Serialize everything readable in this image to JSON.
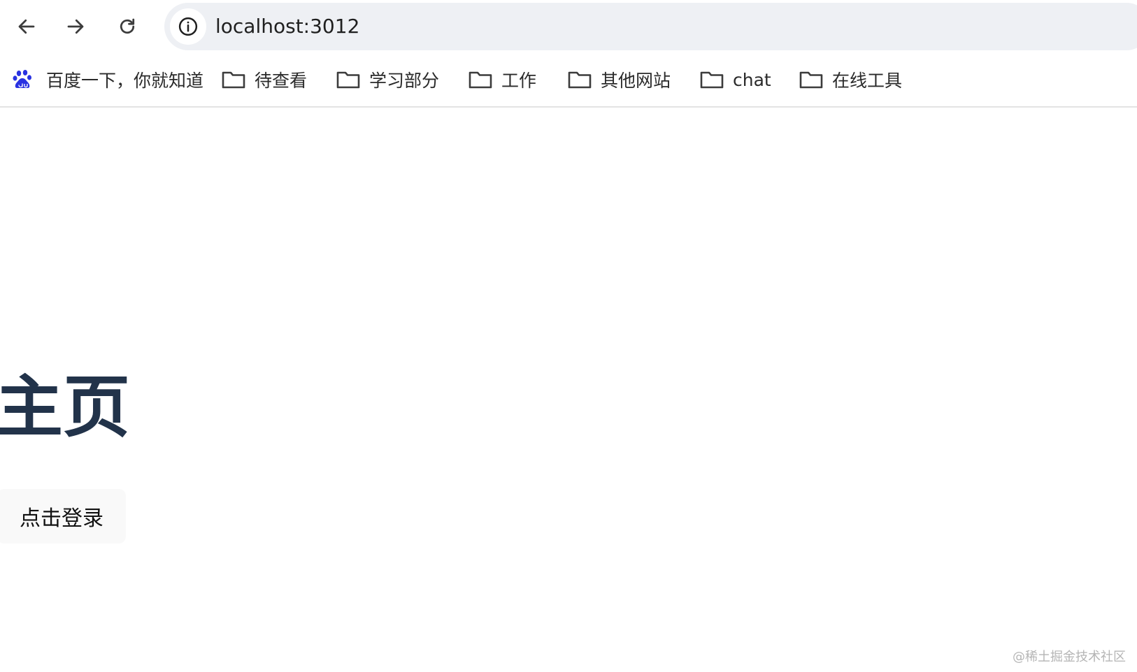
{
  "browser": {
    "back_icon": "arrow-left-icon",
    "forward_icon": "arrow-right-icon",
    "reload_icon": "reload-icon",
    "site_info_icon": "info-circle-icon",
    "url": "localhost:3012"
  },
  "bookmarks": [
    {
      "icon": "baidu-paw-icon",
      "label": "百度一下，你就知道"
    },
    {
      "icon": "folder-icon",
      "label": "待查看"
    },
    {
      "icon": "folder-icon",
      "label": "学习部分"
    },
    {
      "icon": "folder-icon",
      "label": "工作"
    },
    {
      "icon": "folder-icon",
      "label": "其他网站"
    },
    {
      "icon": "folder-icon",
      "label": "chat"
    },
    {
      "icon": "folder-icon",
      "label": "在线工具"
    }
  ],
  "page": {
    "heading": "主页",
    "login_button": "点击登录"
  },
  "watermark": "@稀土掘金技术社区",
  "colors": {
    "heading": "#22334a",
    "address_bar": "#eef0f4",
    "baidu_blue": "#2932e1",
    "button_bg": "#f9f9f9"
  }
}
